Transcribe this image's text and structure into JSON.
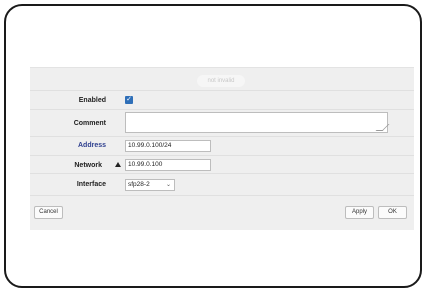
{
  "status_label": "not invalid",
  "form": {
    "enabled_label": "Enabled",
    "enabled_checked": true,
    "comment_label": "Comment",
    "comment_value": "",
    "address_label": "Address",
    "address_value": "10.99.0.100/24",
    "network_label": "Network",
    "network_value": "10.99.0.100",
    "interface_label": "Interface",
    "interface_value": "sfp28-2"
  },
  "buttons": {
    "cancel": "Cancel",
    "apply": "Apply",
    "ok": "OK"
  },
  "icons": {
    "checkmark": "✓",
    "chevron": "⌄"
  }
}
